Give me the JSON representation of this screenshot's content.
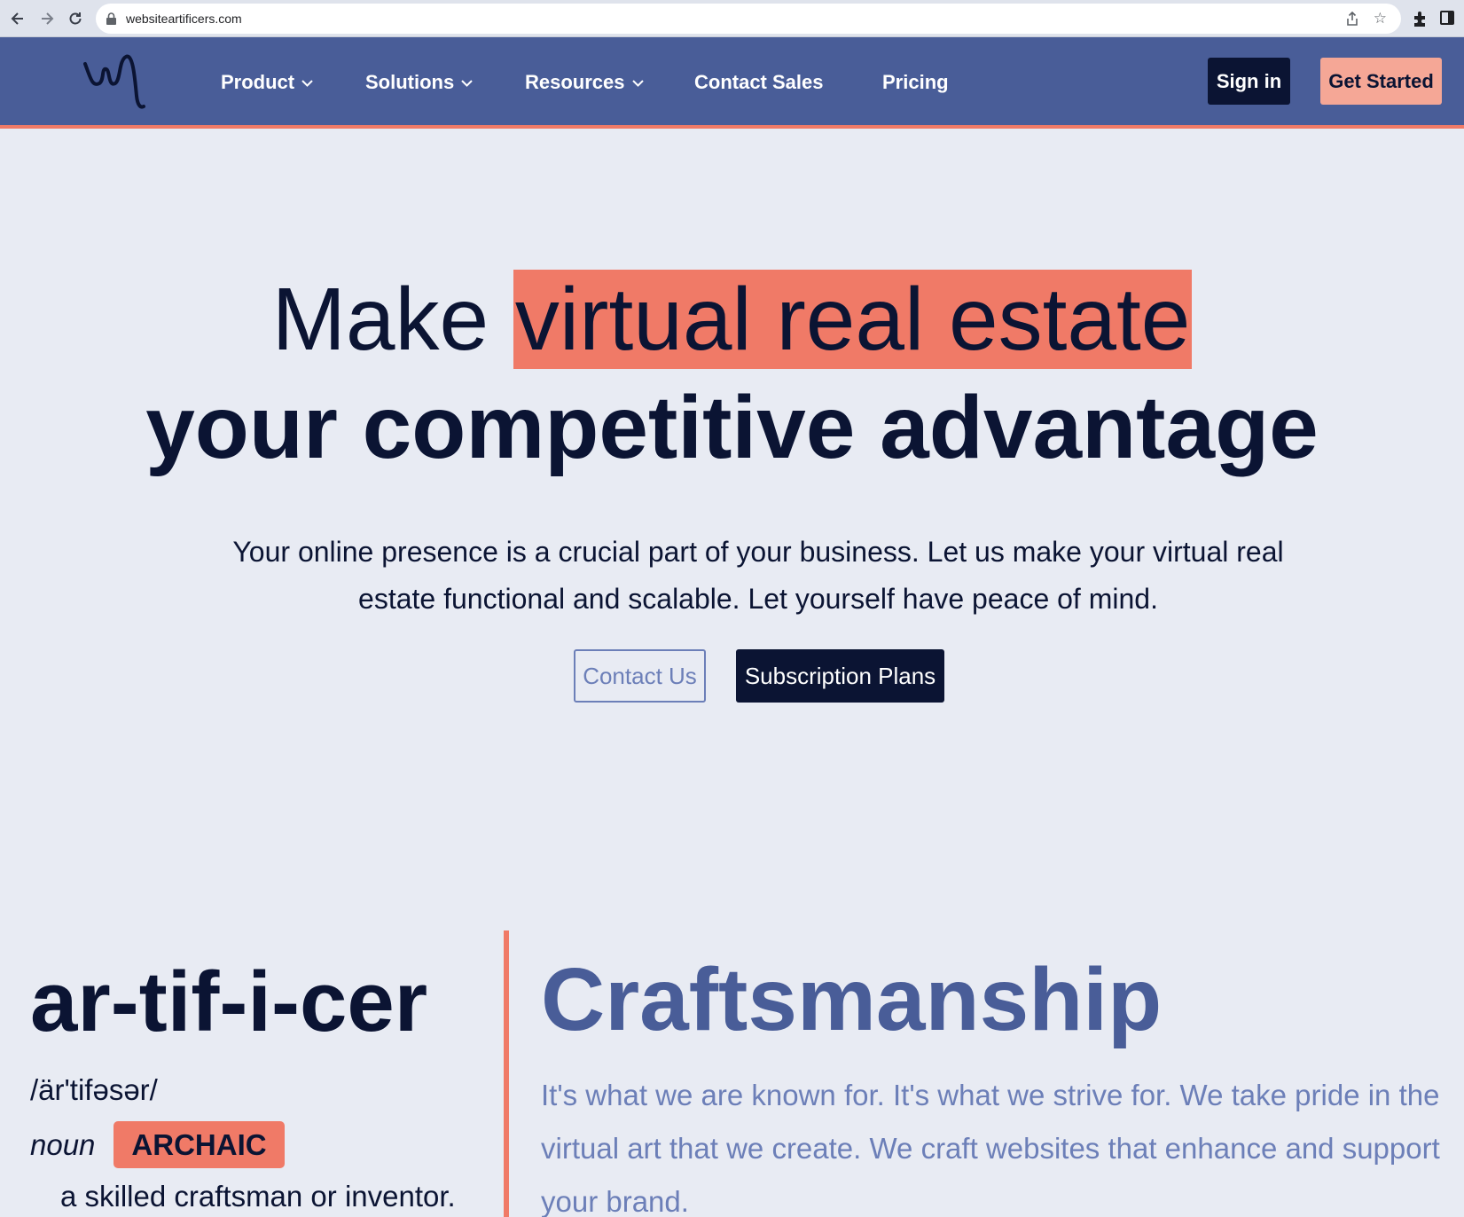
{
  "browser": {
    "url": "websiteartificers.com",
    "icons": [
      "back-icon",
      "forward-icon",
      "reload-icon",
      "lock-icon",
      "share-icon",
      "star-icon",
      "extensions-icon",
      "side-panel-icon"
    ]
  },
  "header": {
    "menu": {
      "product": "Product",
      "solutions": "Solutions",
      "resources": "Resources",
      "contact_sales": "Contact Sales",
      "pricing": "Pricing"
    },
    "sign_in": "Sign in",
    "get_started": "Get Started"
  },
  "hero": {
    "line1_prefix": "Make ",
    "line1_highlight": "virtual real estate",
    "line2": "your competitive advantage",
    "subtitle": "Your online presence is a crucial part of your business. Let us make your virtual real estate functional and scalable. Let yourself have peace of mind.",
    "contact_button": "Contact Us",
    "plans_button": "Subscription Plans"
  },
  "definition": {
    "word": "ar-tif-i-cer",
    "pronunciation": "/är'tifəsər/",
    "part_of_speech": "noun",
    "badge": "ARCHAIC",
    "meaning": "a skilled craftsman or inventor."
  },
  "craftsmanship": {
    "title": "Craftsmanship",
    "lines": [
      "It's what we are known for. It's what we strive for. We take pride in the",
      "virtual art that we create. We craft websites that enhance and support",
      "your brand."
    ]
  },
  "colors": {
    "header_bg": "#495d98",
    "accent_coral": "#f07a67",
    "navy": "#0b1433",
    "page_bg": "#e8ebf3",
    "muted_blue": "#6c7fb8"
  }
}
